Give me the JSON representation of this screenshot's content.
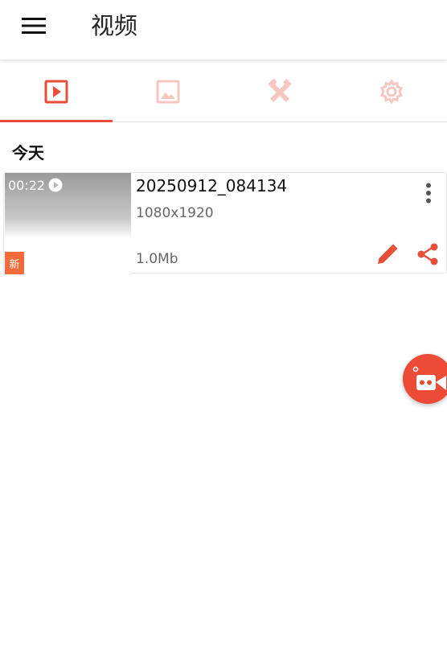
{
  "header": {
    "title": "视频",
    "menu_icon": "hamburger-menu-icon"
  },
  "tabs": [
    {
      "icon": "video-play-icon",
      "active": true
    },
    {
      "icon": "image-icon",
      "active": false
    },
    {
      "icon": "tools-icon",
      "active": false
    },
    {
      "icon": "settings-gear-icon",
      "active": false
    }
  ],
  "section": {
    "label": "今天"
  },
  "videos": [
    {
      "duration": "00:22",
      "badge": "新",
      "name": "20250912_084134",
      "resolution": "1080x1920",
      "size": "1.0Mb"
    }
  ],
  "colors": {
    "accent": "#e84e3a",
    "accent_faded": "#f6c7c0",
    "badge": "#f26b3a",
    "fab": "#ec4b36"
  }
}
